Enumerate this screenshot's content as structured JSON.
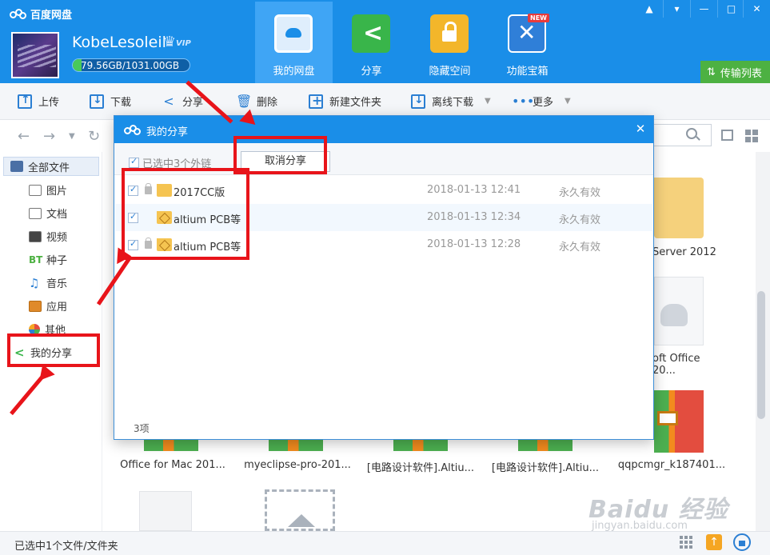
{
  "app": {
    "title": "百度网盘"
  },
  "user": {
    "name": "KobeLesoleil",
    "vip": "VIP",
    "storage_text": "79.56GB/1031.00GB",
    "storage_used_fraction": 0.077
  },
  "nav_tabs": [
    {
      "label": "我的网盘",
      "icon": "cloud-disk-icon",
      "active": true
    },
    {
      "label": "分享",
      "icon": "share-icon",
      "active": false
    },
    {
      "label": "隐藏空间",
      "icon": "lock-icon",
      "active": false
    },
    {
      "label": "功能宝箱",
      "icon": "toolbox-icon",
      "active": false
    }
  ],
  "new_badge": "NEW",
  "transfer_list": "传输列表",
  "toolbar": {
    "upload": "上传",
    "download": "下载",
    "share": "分享",
    "delete": "删除",
    "new_folder": "新建文件夹",
    "offline_download": "离线下载",
    "more": "更多"
  },
  "sidebar": {
    "all_files": "全部文件",
    "items": [
      "图片",
      "文档",
      "视频",
      "种子",
      "音乐",
      "应用",
      "其他",
      "我的分享"
    ],
    "bt_label": "BT"
  },
  "files": {
    "right_col": [
      "Server 2012",
      "oft Office 20...",
      "qqpcmgr_k187401..."
    ],
    "bottom_row": [
      "Office for Mac 201...",
      "myeclipse-pro-201...",
      "[电路设计软件].Altiu...",
      "[电路设计软件].Altiu..."
    ]
  },
  "dialog": {
    "title": "我的分享",
    "select_all": "已选中3个外链",
    "cancel_share": "取消分享",
    "rows": [
      {
        "name": "2017CC版",
        "date": "2018-01-13 12:41",
        "validity": "永久有效",
        "checked": true
      },
      {
        "name": "altium PCB等",
        "date": "2018-01-13 12:34",
        "validity": "永久有效",
        "checked": true
      },
      {
        "name": "altium PCB等",
        "date": "2018-01-13 12:28",
        "validity": "永久有效",
        "checked": true
      }
    ],
    "count": "3项"
  },
  "status": {
    "text": "已选中1个文件/文件夹"
  },
  "watermark": {
    "main": "Baidu 经验",
    "sub": "jingyan.baidu.com"
  },
  "colors": {
    "header_blue": "#1a8ee8",
    "accent_green": "#4db142",
    "annotation_red": "#e8141a"
  }
}
